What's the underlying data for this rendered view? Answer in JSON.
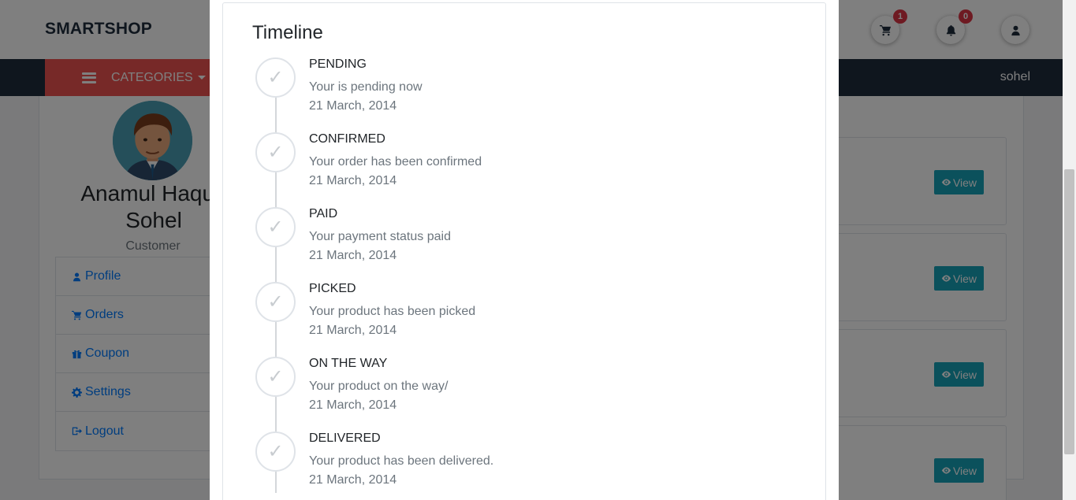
{
  "header": {
    "brand": "SMARTSHOP",
    "cart_count": "1",
    "notification_count": "0"
  },
  "navbar": {
    "categories_label": "CATEGORIES",
    "username": "sohel"
  },
  "profile": {
    "name": "Anamul Haque Sohel",
    "role": "Customer",
    "menu": [
      {
        "label": "Profile",
        "icon": "user-icon"
      },
      {
        "label": "Orders",
        "icon": "cart-icon"
      },
      {
        "label": "Coupon",
        "icon": "gift-icon"
      },
      {
        "label": "Settings",
        "icon": "gear-icon"
      },
      {
        "label": "Logout",
        "icon": "logout-icon"
      }
    ]
  },
  "orders": {
    "view_label": "View"
  },
  "modal": {
    "title": "Timeline",
    "steps": [
      {
        "title": "PENDING",
        "description": "Your is pending now",
        "date": "21 March, 2014"
      },
      {
        "title": "CONFIRMED",
        "description": "Your order has been confirmed",
        "date": "21 March, 2014"
      },
      {
        "title": "PAID",
        "description": "Your payment status paid",
        "date": "21 March, 2014"
      },
      {
        "title": "PICKED",
        "description": "Your product has been picked",
        "date": "21 March, 2014"
      },
      {
        "title": "ON THE WAY",
        "description": "Your product on the way/",
        "date": "21 March, 2014"
      },
      {
        "title": "DELIVERED",
        "description": "Your product has been delivered.",
        "date": "21 March, 2014"
      }
    ]
  },
  "icons": {
    "check": "✓"
  }
}
